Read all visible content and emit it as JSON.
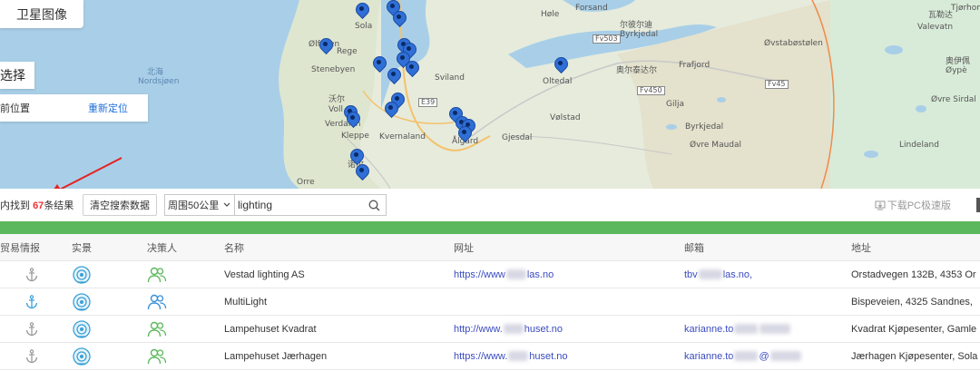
{
  "map": {
    "sat_button_label": "卫星图像",
    "select_label": "选择",
    "location_label": "前位置",
    "relocate_label": "重新定位",
    "labels": [
      "Sola",
      "Rege",
      "Stenebyen",
      "Forsand",
      "Høle",
      "尔彼尔迪",
      "Byrkjedal",
      "Øvstabøstølen",
      "Valevatn",
      "Sviland",
      "奥尔泰达尔",
      "Oltedal",
      "Frafjord",
      "北海",
      "Nordsjøen",
      "Gilja",
      "Vølstad",
      "Ålgård",
      "Gjesdal",
      "Kvernaland",
      "沃尔",
      "Voll",
      "Verdalen",
      "Kleppe",
      "Byrkjedal",
      "Øvre Maudal",
      "Lindeland",
      "Øvre Sirdal",
      "奥伊佩",
      "Øypè",
      "瓦勒达",
      "Tjørhom",
      "Orre",
      "诺尔",
      "E39",
      "Ølfosen"
    ],
    "road_labels": [
      "Fv45",
      "Fv503",
      "Fv450"
    ]
  },
  "toolbar": {
    "result_prefix": "内找到 ",
    "result_count": "67",
    "result_suffix": "条结果",
    "clear_label": "清空搜索数据",
    "radius_value": "周围50公里",
    "search_value": "lighting",
    "download_label": "下载PC极速版"
  },
  "table": {
    "headers": [
      "贸易情报",
      "实景",
      "决策人",
      "名称",
      "网址",
      "邮箱",
      "地址"
    ],
    "rows": [
      {
        "name": "Vestad lighting AS",
        "url_prefix": "https://www",
        "url_suffix": "las.no",
        "email_prefix": "tbv",
        "email_suffix": "las.no,",
        "address": "Orstadvegen 132B, 4353 Or"
      },
      {
        "name": "MultiLight",
        "url_prefix": "",
        "url_suffix": "",
        "email_prefix": "",
        "email_suffix": "",
        "address": "Bispeveien, 4325 Sandnes, "
      },
      {
        "name": "Lampehuset Kvadrat",
        "url_prefix": "http://www.",
        "url_suffix": "huset.no",
        "email_prefix": "karianne.to",
        "email_suffix": "",
        "address": "Kvadrat Kjøpesenter, Gamle"
      },
      {
        "name": "Lampehuset Jærhagen",
        "url_prefix": "https://www.",
        "url_suffix": "huset.no",
        "email_prefix": "karianne.to",
        "email_suffix": "@",
        "address": "Jærhagen Kjøpesenter, Sola"
      }
    ]
  },
  "colors": {
    "green_bar": "#5cb85c",
    "pin": "#2f6fd6",
    "count": "#e33333",
    "link": "#3a4bbf"
  }
}
